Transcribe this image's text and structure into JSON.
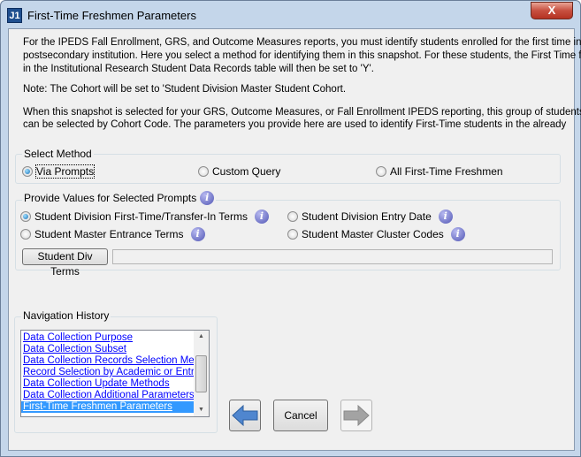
{
  "window": {
    "title": "First-Time Freshmen Parameters",
    "app_icon": "J1",
    "close": "X"
  },
  "intro": {
    "lines": [
      "For the IPEDS Fall Enrollment, GRS, and Outcome Measures reports, you must identify students enrolled for the first time in a",
      "postsecondary institution. Here you select a method for identifying them in this snapshot. For these students, the First Time flag",
      "in the Institutional Research Student Data Records table will then be set to 'Y'."
    ],
    "note": "Note:  The Cohort will be set to 'Student Division Master Student Cohort.",
    "lines2": [
      "When this snapshot is selected for your GRS, Outcome Measures, or Fall Enrollment IPEDS reporting, this group of students",
      "can be selected by Cohort Code. The parameters you provide here are used to identify First-Time students in the already"
    ]
  },
  "select_method": {
    "label": "Select Method",
    "options": [
      {
        "label": "Via Prompts",
        "selected": true
      },
      {
        "label": "Custom Query",
        "selected": false
      },
      {
        "label": "All First-Time Freshmen",
        "selected": false
      }
    ]
  },
  "prompts": {
    "label": "Provide Values for Selected Prompts",
    "options": [
      {
        "label": "Student Division First-Time/Transfer-In Terms",
        "selected": true
      },
      {
        "label": "Student Division Entry Date",
        "selected": false
      },
      {
        "label": "Student Master Entrance Terms",
        "selected": false
      },
      {
        "label": "Student Master Cluster Codes",
        "selected": false
      }
    ],
    "button": "Student Div Terms",
    "value": ""
  },
  "nav_history": {
    "label": "Navigation History",
    "items": [
      "Data Collection Purpose",
      "Data Collection Subset",
      "Data Collection Records Selection Methods",
      "Record Selection by Academic or Entrance",
      "Data Collection Update Methods",
      "Data Collection Additional Parameters",
      "First-Time Freshmen Parameters"
    ],
    "selected_index": 6
  },
  "buttons": {
    "back": "arrow-left-icon",
    "cancel": "Cancel",
    "next": "arrow-right-icon"
  }
}
